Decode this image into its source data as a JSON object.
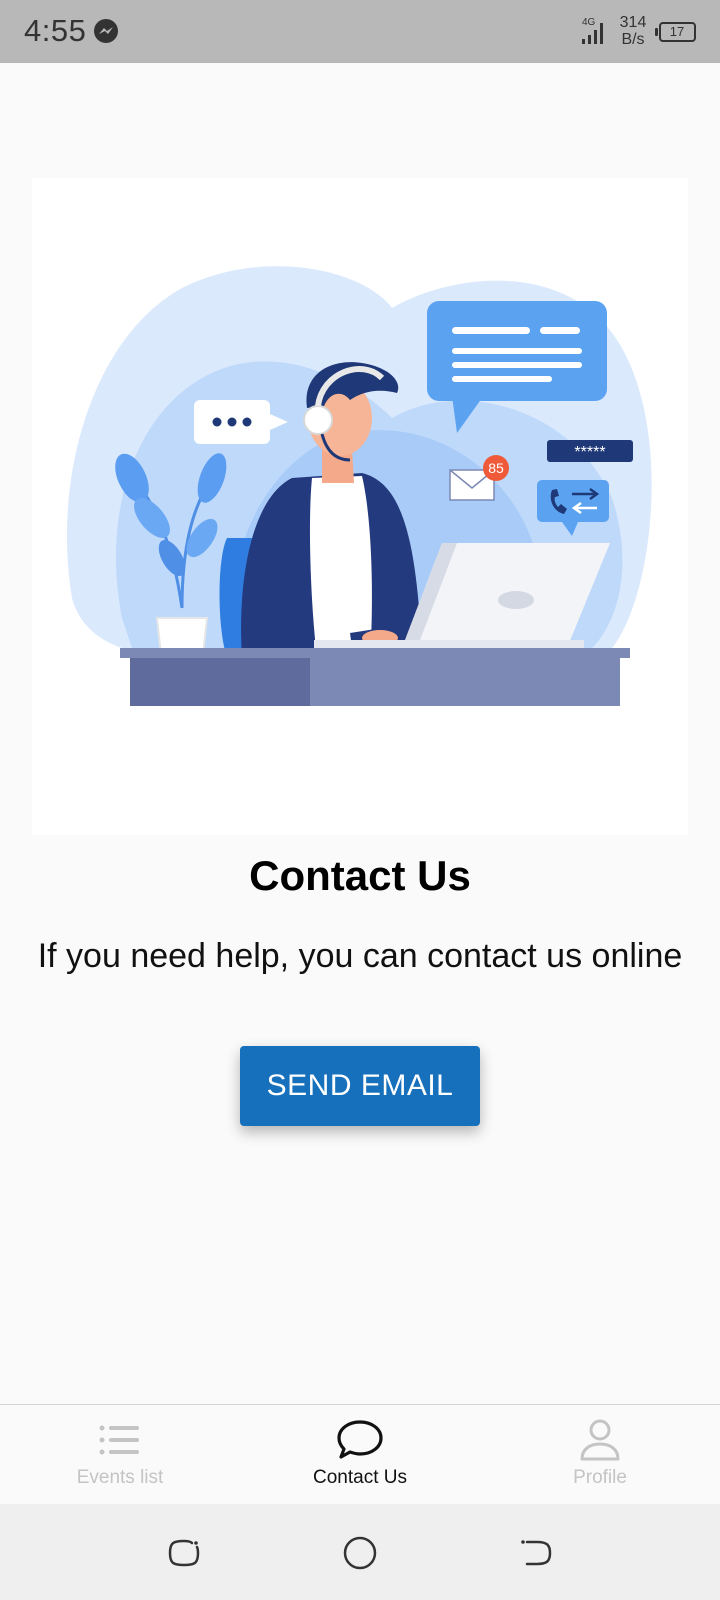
{
  "status_bar": {
    "time": "4:55",
    "network_type": "4G",
    "net_speed_value": "314",
    "net_speed_unit": "B/s",
    "battery_level": "17",
    "icons": [
      "messenger-icon",
      "signal-icon",
      "battery-icon"
    ]
  },
  "main": {
    "title": "Contact Us",
    "subtitle": "If you need help, you can contact us online",
    "send_email_label": "SEND EMAIL",
    "illustration": {
      "notification_count": "85",
      "password_mask": "*****"
    }
  },
  "bottom_nav": {
    "items": [
      {
        "label": "Events list",
        "icon": "list-icon",
        "active": false
      },
      {
        "label": "Contact Us",
        "icon": "chat-bubble-icon",
        "active": true
      },
      {
        "label": "Profile",
        "icon": "person-icon",
        "active": false
      }
    ]
  },
  "system_nav": {
    "icons": [
      "recent-apps-icon",
      "home-icon",
      "back-icon"
    ]
  },
  "colors": {
    "accent": "#1670bb",
    "status_bar": "#b8b8b8",
    "background": "#fafafa",
    "active_nav": "#111111",
    "inactive_nav": "#c4c4c4"
  }
}
